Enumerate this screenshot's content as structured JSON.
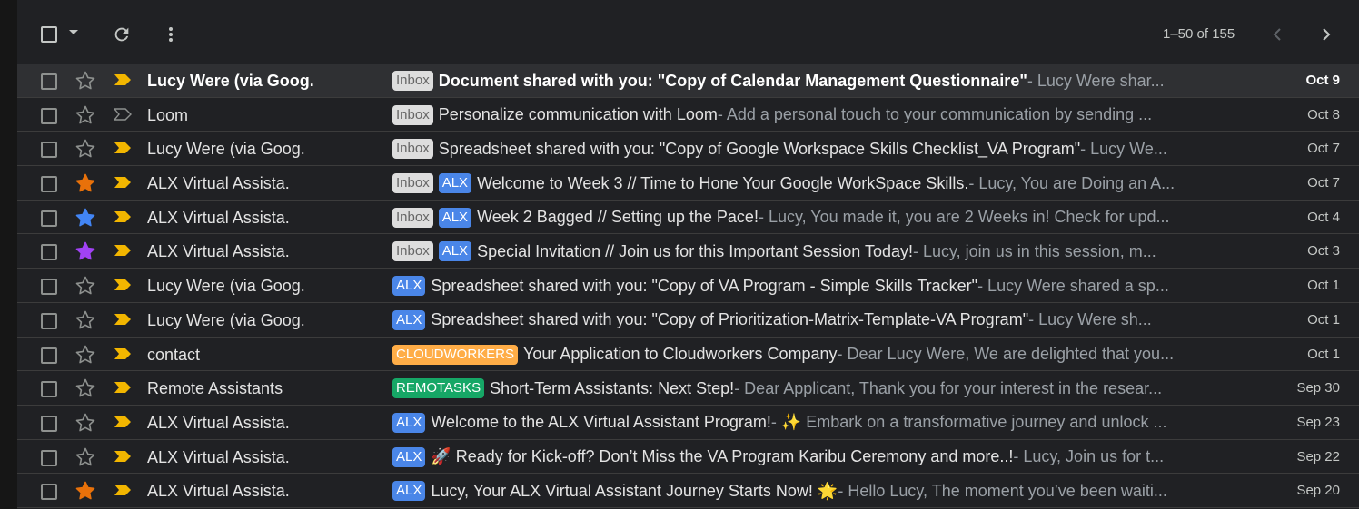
{
  "toolbar": {
    "select_icon": "checkbox-icon",
    "dropdown_icon": "caret-down-icon",
    "refresh_icon": "refresh-icon",
    "more_icon": "more-vert-icon",
    "pagination": "1–50 of 155",
    "prev_icon": "chevron-left-icon",
    "next_icon": "chevron-right-icon"
  },
  "colors": {
    "star_orange": "#e8710a",
    "star_blue": "#4285f4",
    "star_purple": "#a142f4",
    "important": "#f2b600",
    "alx_label": "#4a86e8",
    "cloudworkers_label": "#ffad47",
    "remotasks_label": "#16a766"
  },
  "emails": [
    {
      "sender": "Lucy Were (via Goog.",
      "labels": [
        {
          "text": "Inbox",
          "kind": "inbox"
        }
      ],
      "subject": "Document shared with you: \"Copy of Calendar Management Questionnaire\"",
      "snippet": " - Lucy Were shar...",
      "date": "Oct 9",
      "unread": true,
      "star": "none",
      "important": true
    },
    {
      "sender": "Loom",
      "labels": [
        {
          "text": "Inbox",
          "kind": "inbox"
        }
      ],
      "subject": "Personalize communication with Loom",
      "snippet": " - Add a personal touch to your communication by sending ...",
      "date": "Oct 8",
      "unread": false,
      "star": "none",
      "important": false
    },
    {
      "sender": "Lucy Were (via Goog.",
      "labels": [
        {
          "text": "Inbox",
          "kind": "inbox"
        }
      ],
      "subject": "Spreadsheet shared with you: \"Copy of Google Workspace Skills Checklist_VA Program\"",
      "snippet": " - Lucy We...",
      "date": "Oct 7",
      "unread": false,
      "star": "none",
      "important": true
    },
    {
      "sender": "ALX Virtual Assista.",
      "labels": [
        {
          "text": "Inbox",
          "kind": "inbox"
        },
        {
          "text": "ALX",
          "kind": "alx"
        }
      ],
      "subject": "Welcome to Week 3 // Time to Hone Your Google WorkSpace Skills.",
      "snippet": " - Lucy, You are Doing an A...",
      "date": "Oct 7",
      "unread": false,
      "star": "orange",
      "important": true
    },
    {
      "sender": "ALX Virtual Assista.",
      "labels": [
        {
          "text": "Inbox",
          "kind": "inbox"
        },
        {
          "text": "ALX",
          "kind": "alx"
        }
      ],
      "subject": "Week 2 Bagged // Setting up the Pace!",
      "snippet": " - Lucy, You made it, you are 2 Weeks in! Check for upd...",
      "date": "Oct 4",
      "unread": false,
      "star": "blue",
      "important": true
    },
    {
      "sender": "ALX Virtual Assista.",
      "labels": [
        {
          "text": "Inbox",
          "kind": "inbox"
        },
        {
          "text": "ALX",
          "kind": "alx"
        }
      ],
      "subject": "Special Invitation // Join us for this Important Session Today!",
      "snippet": " - Lucy, join us in this session, m...",
      "date": "Oct 3",
      "unread": false,
      "star": "purple",
      "important": true
    },
    {
      "sender": "Lucy Were (via Goog.",
      "labels": [
        {
          "text": "ALX",
          "kind": "alx"
        }
      ],
      "subject": "Spreadsheet shared with you: \"Copy of VA Program - Simple Skills Tracker\"",
      "snippet": " - Lucy Were shared a sp...",
      "date": "Oct 1",
      "unread": false,
      "star": "none",
      "important": true
    },
    {
      "sender": "Lucy Were (via Goog.",
      "labels": [
        {
          "text": "ALX",
          "kind": "alx"
        }
      ],
      "subject": "Spreadsheet shared with you: \"Copy of Prioritization-Matrix-Template-VA Program\"",
      "snippet": " - Lucy Were sh...",
      "date": "Oct 1",
      "unread": false,
      "star": "none",
      "important": true
    },
    {
      "sender": "contact",
      "labels": [
        {
          "text": "CLOUDWORKERS",
          "kind": "cw"
        }
      ],
      "subject": "Your Application to Cloudworkers Company",
      "snippet": " - Dear Lucy Were, We are delighted that you...",
      "date": "Oct 1",
      "unread": false,
      "star": "none",
      "important": true
    },
    {
      "sender": "Remote Assistants",
      "labels": [
        {
          "text": "REMOTASKS",
          "kind": "rt"
        }
      ],
      "subject": "Short-Term Assistants: Next Step!",
      "snippet": " - Dear Applicant, Thank you for your interest in the resear...",
      "date": "Sep 30",
      "unread": false,
      "star": "none",
      "important": true
    },
    {
      "sender": "ALX Virtual Assista.",
      "labels": [
        {
          "text": "ALX",
          "kind": "alx"
        }
      ],
      "subject": "Welcome to the ALX Virtual Assistant Program!",
      "snippet": " - ✨ Embark on a transformative journey and unlock ...",
      "date": "Sep 23",
      "unread": false,
      "star": "none",
      "important": true
    },
    {
      "sender": "ALX Virtual Assista.",
      "labels": [
        {
          "text": "ALX",
          "kind": "alx"
        }
      ],
      "subject": "🚀 Ready for Kick-off? Don’t Miss the VA Program Karibu Ceremony and more..!",
      "snippet": " - Lucy, Join us for t...",
      "date": "Sep 22",
      "unread": false,
      "star": "none",
      "important": true
    },
    {
      "sender": "ALX Virtual Assista.",
      "labels": [
        {
          "text": "ALX",
          "kind": "alx"
        }
      ],
      "subject": "Lucy, Your ALX Virtual Assistant Journey Starts Now! 🌟",
      "snippet": " - Hello Lucy, The moment you’ve been waiti...",
      "date": "Sep 20",
      "unread": false,
      "star": "orange",
      "important": true
    }
  ]
}
